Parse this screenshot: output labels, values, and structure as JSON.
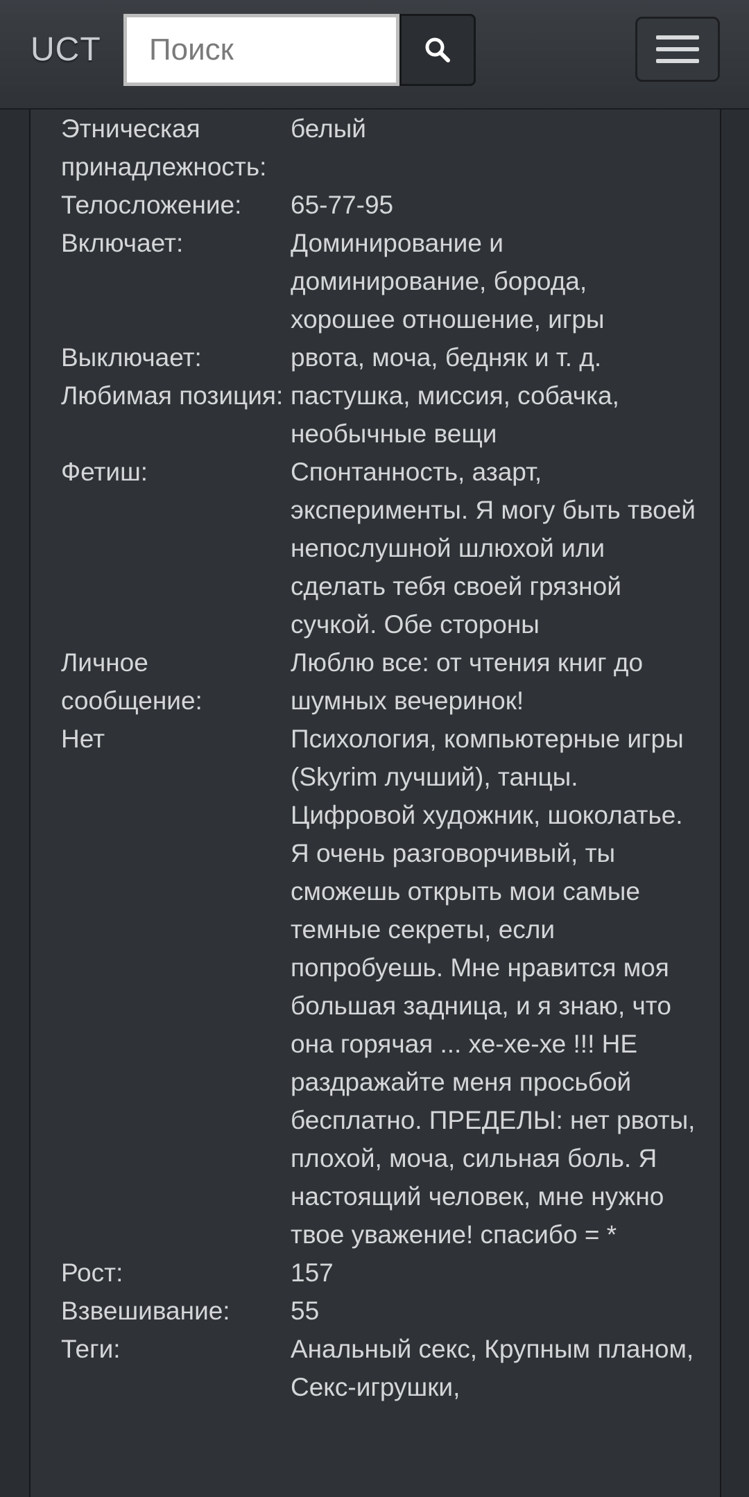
{
  "header": {
    "logo": "UCT",
    "search_placeholder": "Поиск"
  },
  "profile": [
    {
      "label": "Этническая принадлежность:",
      "value": "белый"
    },
    {
      "label": "Телосложение:",
      "value": "65-77-95"
    },
    {
      "label": "Включает:",
      "value": "Доминирование и доминирование, борода, хорошее отношение, игры"
    },
    {
      "label": "Выключает:",
      "value": "рвота, моча, бедняк и т. д."
    },
    {
      "label": "Любимая позиция:",
      "value": "пастушка, миссия, собачка, необычные вещи"
    },
    {
      "label": "Фетиш:",
      "value": "Спонтанность, азарт, эксперименты. Я могу быть твоей непослушной шлюхой или сделать тебя своей грязной сучкой. Обе стороны"
    },
    {
      "label": "Личное сообщение:",
      "value": "Люблю все: от чтения книг до шумных вечеринок!"
    },
    {
      "label": "Нет",
      "value": "Психология, компьютерные игры (Skyrim лучший), танцы. Цифровой художник, шоколатье. Я очень разговорчивый, ты сможешь открыть мои самые темные секреты, если попробуешь. Мне нравится моя большая задница, и я знаю, что она горячая ... хе-хе-хе !!! НЕ раздражайте меня просьбой бесплатно. ПРЕДЕЛЫ: нет рвоты, плохой, моча, сильная боль. Я настоящий человек, мне нужно твое уважение! спасибо = *"
    },
    {
      "label": "Рост:",
      "value": "157"
    },
    {
      "label": "Взвешивание:",
      "value": "55"
    },
    {
      "label": "Теги:",
      "value": "Анальный секс, Крупным планом, Секс-игрушки,"
    }
  ],
  "icons": {
    "search": "search-icon",
    "menu": "menu-icon"
  }
}
